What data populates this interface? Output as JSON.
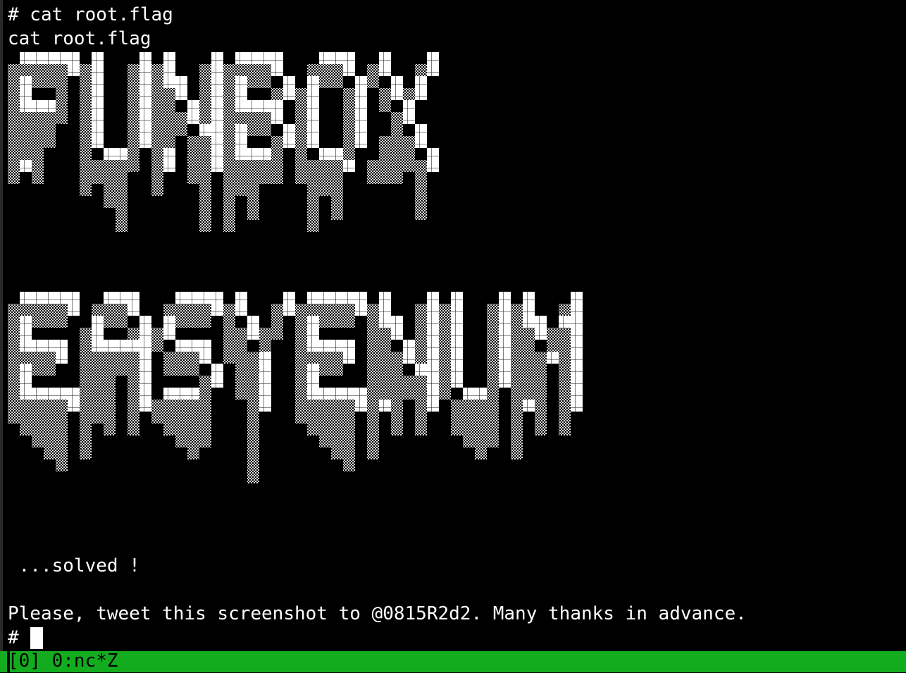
{
  "terminal": {
    "lines": [
      "# cat root.flag",
      "cat root.flag",
      " ...solved !",
      "Please, tweet this screenshot to @0815R2d2. Many thanks in advance.",
      "# "
    ]
  },
  "art": {
    "lines": [
      "FUNBOX",
      "EASYENUM"
    ],
    "colors": {
      "solid": "#ffffff",
      "shade": "#cfcfcf",
      "background": "#000000"
    }
  },
  "statusbar": {
    "text": "[0] 0:nc*Z",
    "color": "#13ac1f"
  }
}
